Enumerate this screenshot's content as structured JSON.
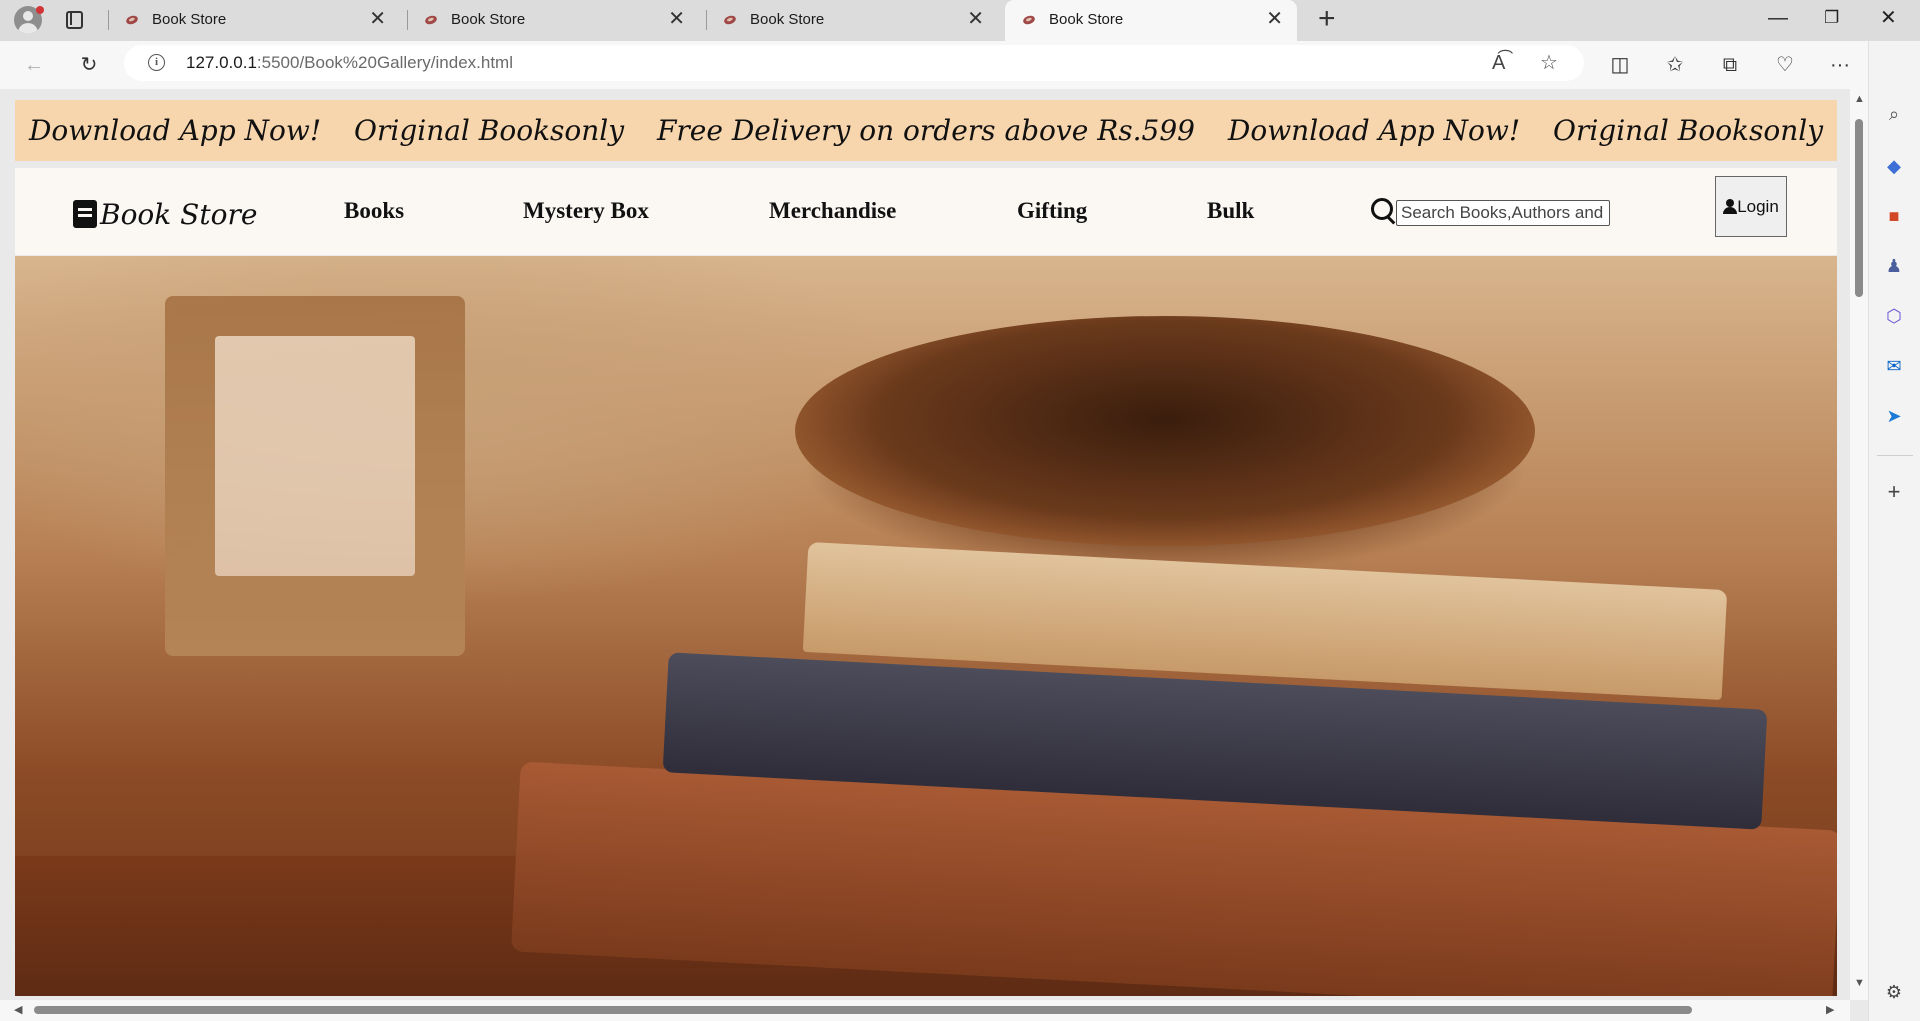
{
  "browser": {
    "tabs": [
      {
        "title": "Book Store",
        "active": false
      },
      {
        "title": "Book Store",
        "active": false
      },
      {
        "title": "Book Store",
        "active": false
      },
      {
        "title": "Book Store",
        "active": true
      }
    ],
    "address": {
      "host": "127.0.0.1",
      "path": ":5500/Book%20Gallery/index.html"
    },
    "icons": {
      "back": "back-arrow-icon",
      "refresh": "refresh-icon",
      "info": "site-info-icon",
      "read_aloud": "read-aloud-icon",
      "favorite": "star-icon",
      "split": "split-screen-icon",
      "favorites": "favorites-icon",
      "collections": "collections-icon",
      "wallet": "browser-essentials-icon",
      "more": "more-icon",
      "copilot": "copilot-icon"
    }
  },
  "page": {
    "announcement": [
      "Download App Now!",
      "Original Booksonly",
      "Free Delivery on orders above Rs.599",
      "Download App Now!",
      "Original Booksonly"
    ],
    "logo": "Book Store",
    "nav": [
      "Books",
      "Mystery Box",
      "Merchandise",
      "Gifting",
      "Bulk"
    ],
    "search": {
      "placeholder": "Search Books,Authors and"
    },
    "login_label": "Login"
  },
  "colors": {
    "announcement_bg": "#f8d6ad",
    "navbar_bg": "#fbf8f3",
    "accent": "#0b57d0"
  }
}
